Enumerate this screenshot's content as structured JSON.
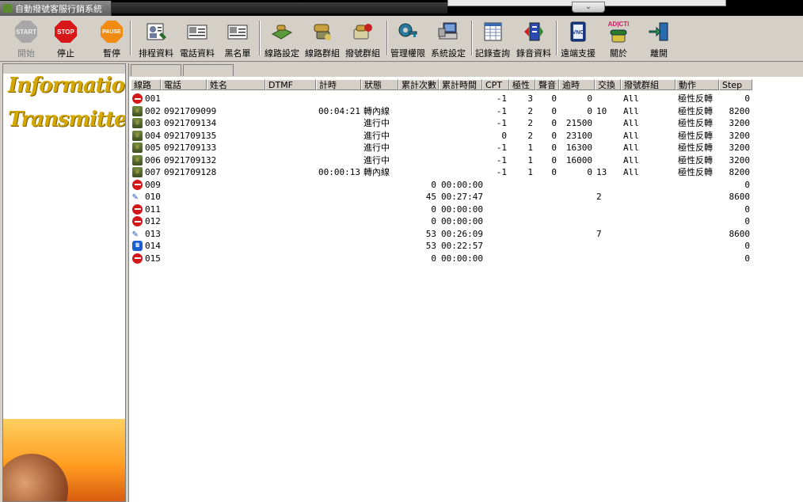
{
  "window": {
    "title": "自動撥號客服行銷系統"
  },
  "toolbar": {
    "start": {
      "badge": "START",
      "label": "開始"
    },
    "stop": {
      "badge": "STOP",
      "label": "停止"
    },
    "pause": {
      "badge": "PAUSE",
      "label": "暫停"
    },
    "schedule": "排程資料",
    "phone_data": "電話資料",
    "blacklist": "黑名單",
    "line_settings": "線路設定",
    "line_group": "線路群組",
    "dial_group": "撥號群組",
    "permissions": "管理權限",
    "system_settings": "系統設定",
    "record_query": "記錄查詢",
    "recording_data": "錄音資料",
    "remote_support": "遠端支援",
    "about_badge": "AD|CTI",
    "about": "關於",
    "exit": "離開"
  },
  "sidebar": {
    "logo_line1": "Information",
    "logo_line2": "Transmitters"
  },
  "table": {
    "columns": [
      "線路",
      "電話",
      "姓名",
      "DTMF",
      "計時",
      "狀態",
      "累計次數",
      "累計時間",
      "CPT",
      "極性",
      "聲音",
      "逾時",
      "交換",
      "撥號群組",
      "動作",
      "Step"
    ],
    "rows": [
      {
        "icon": "busy",
        "line": "001",
        "phone": "",
        "timer": "",
        "status": "",
        "count": "",
        "total": "",
        "cpt": "-1",
        "polarity": "3",
        "sound": "0",
        "timeout": "0",
        "exchange": "",
        "group": "All",
        "action": "極性反轉",
        "step": "0"
      },
      {
        "icon": "phone",
        "line": "002",
        "phone": "0921709099",
        "timer": "00:04:21",
        "status": "轉內線",
        "count": "",
        "total": "",
        "cpt": "-1",
        "polarity": "2",
        "sound": "0",
        "timeout": "0",
        "exchange": "10",
        "group": "All",
        "action": "極性反轉",
        "step": "8200"
      },
      {
        "icon": "phone",
        "line": "003",
        "phone": "0921709134",
        "timer": "",
        "status": "進行中",
        "count": "",
        "total": "",
        "cpt": "-1",
        "polarity": "2",
        "sound": "0",
        "timeout": "21500",
        "exchange": "",
        "group": "All",
        "action": "極性反轉",
        "step": "3200"
      },
      {
        "icon": "phone",
        "line": "004",
        "phone": "0921709135",
        "timer": "",
        "status": "進行中",
        "count": "",
        "total": "",
        "cpt": "0",
        "polarity": "2",
        "sound": "0",
        "timeout": "23100",
        "exchange": "",
        "group": "All",
        "action": "極性反轉",
        "step": "3200"
      },
      {
        "icon": "phone",
        "line": "005",
        "phone": "0921709133",
        "timer": "",
        "status": "進行中",
        "count": "",
        "total": "",
        "cpt": "-1",
        "polarity": "1",
        "sound": "0",
        "timeout": "16300",
        "exchange": "",
        "group": "All",
        "action": "極性反轉",
        "step": "3200"
      },
      {
        "icon": "phone",
        "line": "006",
        "phone": "0921709132",
        "timer": "",
        "status": "進行中",
        "count": "",
        "total": "",
        "cpt": "-1",
        "polarity": "1",
        "sound": "0",
        "timeout": "16000",
        "exchange": "",
        "group": "All",
        "action": "極性反轉",
        "step": "3200"
      },
      {
        "icon": "phone",
        "line": "007",
        "phone": "0921709128",
        "timer": "00:00:13",
        "status": "轉內線",
        "count": "",
        "total": "",
        "cpt": "-1",
        "polarity": "1",
        "sound": "0",
        "timeout": "0",
        "exchange": "13",
        "group": "All",
        "action": "極性反轉",
        "step": "8200"
      },
      {
        "icon": "busy",
        "line": "009",
        "phone": "",
        "timer": "",
        "status": "",
        "count": "0",
        "total": "00:00:00",
        "cpt": "",
        "polarity": "",
        "sound": "",
        "timeout": "",
        "exchange": "",
        "group": "",
        "action": "",
        "step": "0"
      },
      {
        "icon": "plug",
        "line": "010",
        "phone": "",
        "timer": "",
        "status": "",
        "count": "45",
        "total": "00:27:47",
        "cpt": "",
        "polarity": "",
        "sound": "",
        "timeout": "",
        "exchange": "2",
        "group": "",
        "action": "",
        "step": "8600"
      },
      {
        "icon": "busy",
        "line": "011",
        "phone": "",
        "timer": "",
        "status": "",
        "count": "0",
        "total": "00:00:00",
        "cpt": "",
        "polarity": "",
        "sound": "",
        "timeout": "",
        "exchange": "",
        "group": "",
        "action": "",
        "step": "0"
      },
      {
        "icon": "busy",
        "line": "012",
        "phone": "",
        "timer": "",
        "status": "",
        "count": "0",
        "total": "00:00:00",
        "cpt": "",
        "polarity": "",
        "sound": "",
        "timeout": "",
        "exchange": "",
        "group": "",
        "action": "",
        "step": "0"
      },
      {
        "icon": "plug",
        "line": "013",
        "phone": "",
        "timer": "",
        "status": "",
        "count": "53",
        "total": "00:26:09",
        "cpt": "",
        "polarity": "",
        "sound": "",
        "timeout": "",
        "exchange": "7",
        "group": "",
        "action": "",
        "step": "8600"
      },
      {
        "icon": "blue",
        "line": "014",
        "phone": "",
        "timer": "",
        "status": "",
        "count": "53",
        "total": "00:22:57",
        "cpt": "",
        "polarity": "",
        "sound": "",
        "timeout": "",
        "exchange": "",
        "group": "",
        "action": "",
        "step": "0"
      },
      {
        "icon": "busy",
        "line": "015",
        "phone": "",
        "timer": "",
        "status": "",
        "count": "0",
        "total": "00:00:00",
        "cpt": "",
        "polarity": "",
        "sound": "",
        "timeout": "",
        "exchange": "",
        "group": "",
        "action": "",
        "step": "0"
      }
    ]
  }
}
